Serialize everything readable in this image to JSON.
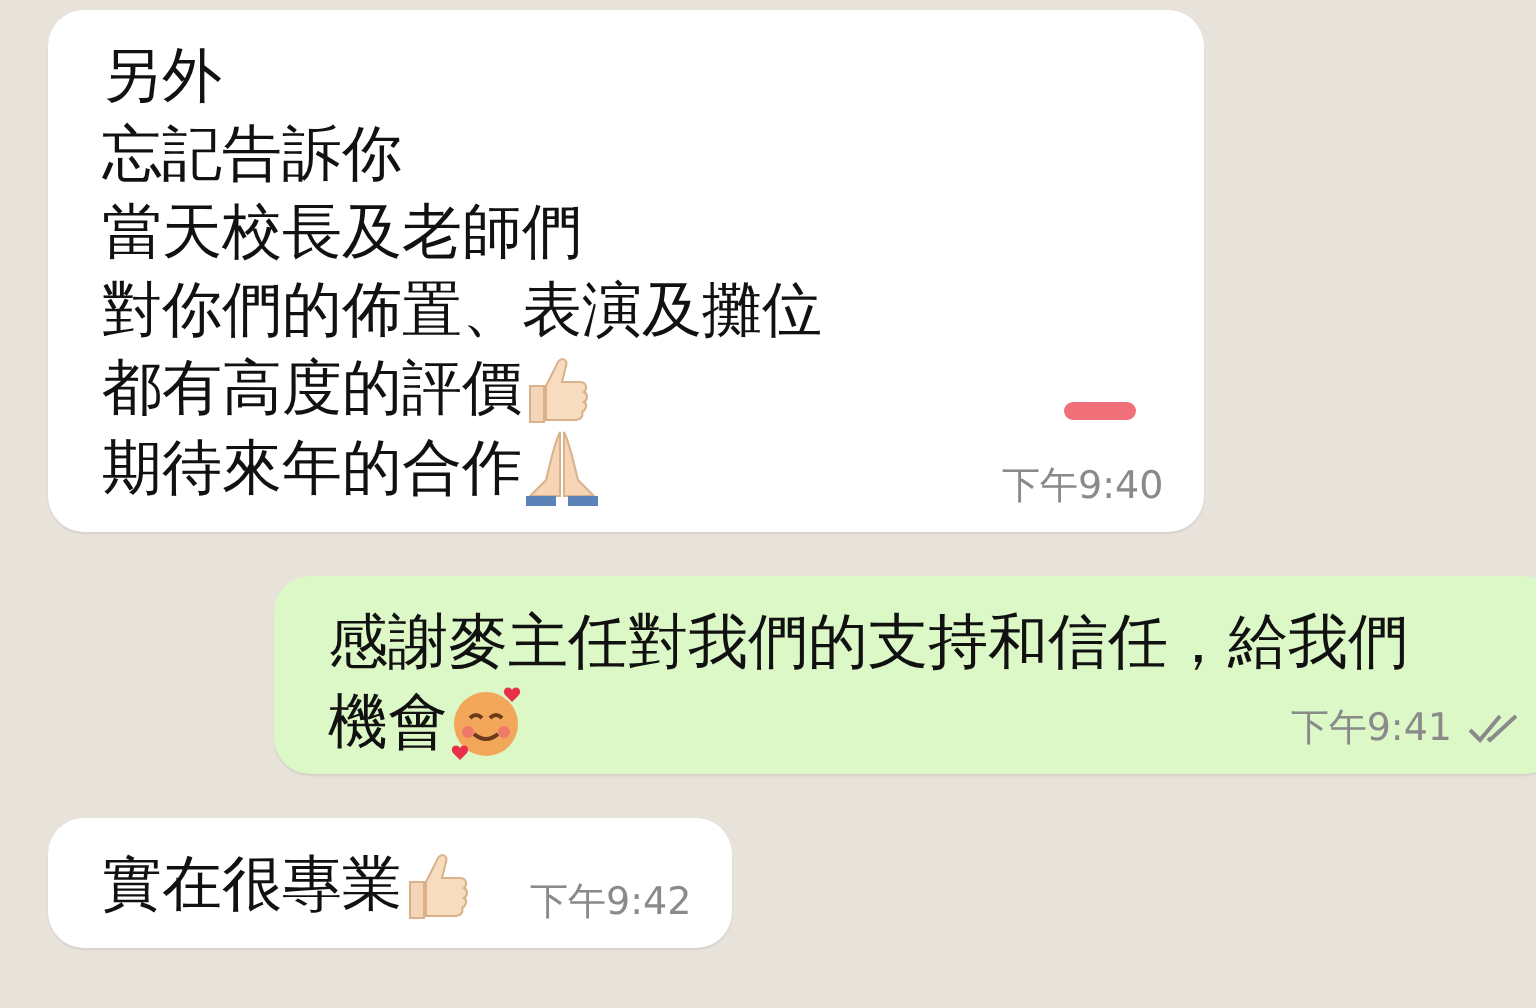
{
  "messages": [
    {
      "kind": "incoming",
      "redacted": true,
      "time": "下午9:40",
      "lines": [
        {
          "kind": "text",
          "text": "另外"
        },
        {
          "kind": "text",
          "text": "忘記告訴你"
        },
        {
          "kind": "text",
          "text": "當天校長及老師們"
        },
        {
          "kind": "text",
          "text": "對你們的佈置、表演及攤位"
        },
        {
          "kind": "thumbsup",
          "text": "都有高度的評價"
        },
        {
          "kind": "pray",
          "text": "期待來年的合作"
        }
      ]
    },
    {
      "kind": "outgoing",
      "read": false,
      "time": "下午9:41",
      "lines": [
        {
          "kind": "text",
          "text": "感謝麥主任對我們的支持和信任，給我們"
        },
        {
          "kind": "smile",
          "text": "機會"
        }
      ]
    },
    {
      "kind": "incoming",
      "time": "下午9:42",
      "lines": [
        {
          "kind": "thumbsup",
          "text": "實在很專業"
        }
      ]
    }
  ]
}
